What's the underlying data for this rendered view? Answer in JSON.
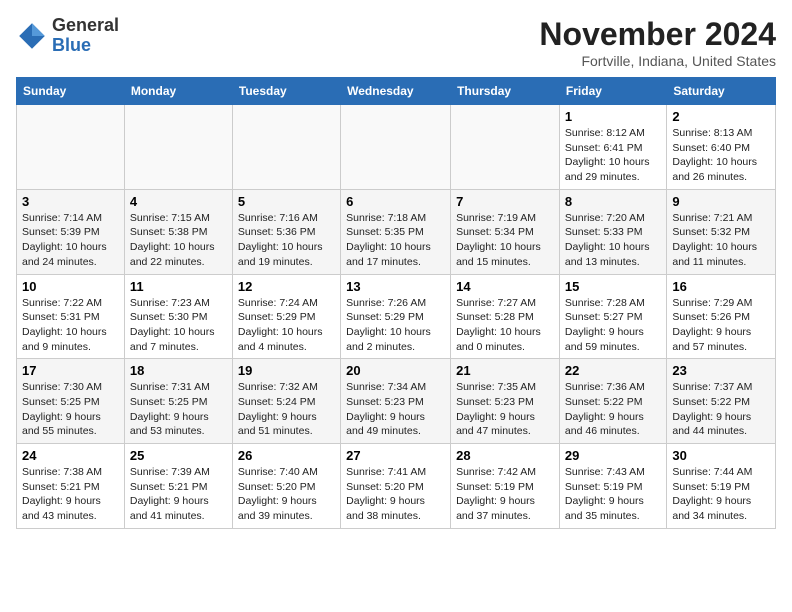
{
  "header": {
    "logo_general": "General",
    "logo_blue": "Blue",
    "month_title": "November 2024",
    "location": "Fortville, Indiana, United States"
  },
  "columns": [
    "Sunday",
    "Monday",
    "Tuesday",
    "Wednesday",
    "Thursday",
    "Friday",
    "Saturday"
  ],
  "weeks": [
    [
      {
        "day": "",
        "info": ""
      },
      {
        "day": "",
        "info": ""
      },
      {
        "day": "",
        "info": ""
      },
      {
        "day": "",
        "info": ""
      },
      {
        "day": "",
        "info": ""
      },
      {
        "day": "1",
        "info": "Sunrise: 8:12 AM\nSunset: 6:41 PM\nDaylight: 10 hours and 29 minutes."
      },
      {
        "day": "2",
        "info": "Sunrise: 8:13 AM\nSunset: 6:40 PM\nDaylight: 10 hours and 26 minutes."
      }
    ],
    [
      {
        "day": "3",
        "info": "Sunrise: 7:14 AM\nSunset: 5:39 PM\nDaylight: 10 hours and 24 minutes."
      },
      {
        "day": "4",
        "info": "Sunrise: 7:15 AM\nSunset: 5:38 PM\nDaylight: 10 hours and 22 minutes."
      },
      {
        "day": "5",
        "info": "Sunrise: 7:16 AM\nSunset: 5:36 PM\nDaylight: 10 hours and 19 minutes."
      },
      {
        "day": "6",
        "info": "Sunrise: 7:18 AM\nSunset: 5:35 PM\nDaylight: 10 hours and 17 minutes."
      },
      {
        "day": "7",
        "info": "Sunrise: 7:19 AM\nSunset: 5:34 PM\nDaylight: 10 hours and 15 minutes."
      },
      {
        "day": "8",
        "info": "Sunrise: 7:20 AM\nSunset: 5:33 PM\nDaylight: 10 hours and 13 minutes."
      },
      {
        "day": "9",
        "info": "Sunrise: 7:21 AM\nSunset: 5:32 PM\nDaylight: 10 hours and 11 minutes."
      }
    ],
    [
      {
        "day": "10",
        "info": "Sunrise: 7:22 AM\nSunset: 5:31 PM\nDaylight: 10 hours and 9 minutes."
      },
      {
        "day": "11",
        "info": "Sunrise: 7:23 AM\nSunset: 5:30 PM\nDaylight: 10 hours and 7 minutes."
      },
      {
        "day": "12",
        "info": "Sunrise: 7:24 AM\nSunset: 5:29 PM\nDaylight: 10 hours and 4 minutes."
      },
      {
        "day": "13",
        "info": "Sunrise: 7:26 AM\nSunset: 5:29 PM\nDaylight: 10 hours and 2 minutes."
      },
      {
        "day": "14",
        "info": "Sunrise: 7:27 AM\nSunset: 5:28 PM\nDaylight: 10 hours and 0 minutes."
      },
      {
        "day": "15",
        "info": "Sunrise: 7:28 AM\nSunset: 5:27 PM\nDaylight: 9 hours and 59 minutes."
      },
      {
        "day": "16",
        "info": "Sunrise: 7:29 AM\nSunset: 5:26 PM\nDaylight: 9 hours and 57 minutes."
      }
    ],
    [
      {
        "day": "17",
        "info": "Sunrise: 7:30 AM\nSunset: 5:25 PM\nDaylight: 9 hours and 55 minutes."
      },
      {
        "day": "18",
        "info": "Sunrise: 7:31 AM\nSunset: 5:25 PM\nDaylight: 9 hours and 53 minutes."
      },
      {
        "day": "19",
        "info": "Sunrise: 7:32 AM\nSunset: 5:24 PM\nDaylight: 9 hours and 51 minutes."
      },
      {
        "day": "20",
        "info": "Sunrise: 7:34 AM\nSunset: 5:23 PM\nDaylight: 9 hours and 49 minutes."
      },
      {
        "day": "21",
        "info": "Sunrise: 7:35 AM\nSunset: 5:23 PM\nDaylight: 9 hours and 47 minutes."
      },
      {
        "day": "22",
        "info": "Sunrise: 7:36 AM\nSunset: 5:22 PM\nDaylight: 9 hours and 46 minutes."
      },
      {
        "day": "23",
        "info": "Sunrise: 7:37 AM\nSunset: 5:22 PM\nDaylight: 9 hours and 44 minutes."
      }
    ],
    [
      {
        "day": "24",
        "info": "Sunrise: 7:38 AM\nSunset: 5:21 PM\nDaylight: 9 hours and 43 minutes."
      },
      {
        "day": "25",
        "info": "Sunrise: 7:39 AM\nSunset: 5:21 PM\nDaylight: 9 hours and 41 minutes."
      },
      {
        "day": "26",
        "info": "Sunrise: 7:40 AM\nSunset: 5:20 PM\nDaylight: 9 hours and 39 minutes."
      },
      {
        "day": "27",
        "info": "Sunrise: 7:41 AM\nSunset: 5:20 PM\nDaylight: 9 hours and 38 minutes."
      },
      {
        "day": "28",
        "info": "Sunrise: 7:42 AM\nSunset: 5:19 PM\nDaylight: 9 hours and 37 minutes."
      },
      {
        "day": "29",
        "info": "Sunrise: 7:43 AM\nSunset: 5:19 PM\nDaylight: 9 hours and 35 minutes."
      },
      {
        "day": "30",
        "info": "Sunrise: 7:44 AM\nSunset: 5:19 PM\nDaylight: 9 hours and 34 minutes."
      }
    ]
  ]
}
